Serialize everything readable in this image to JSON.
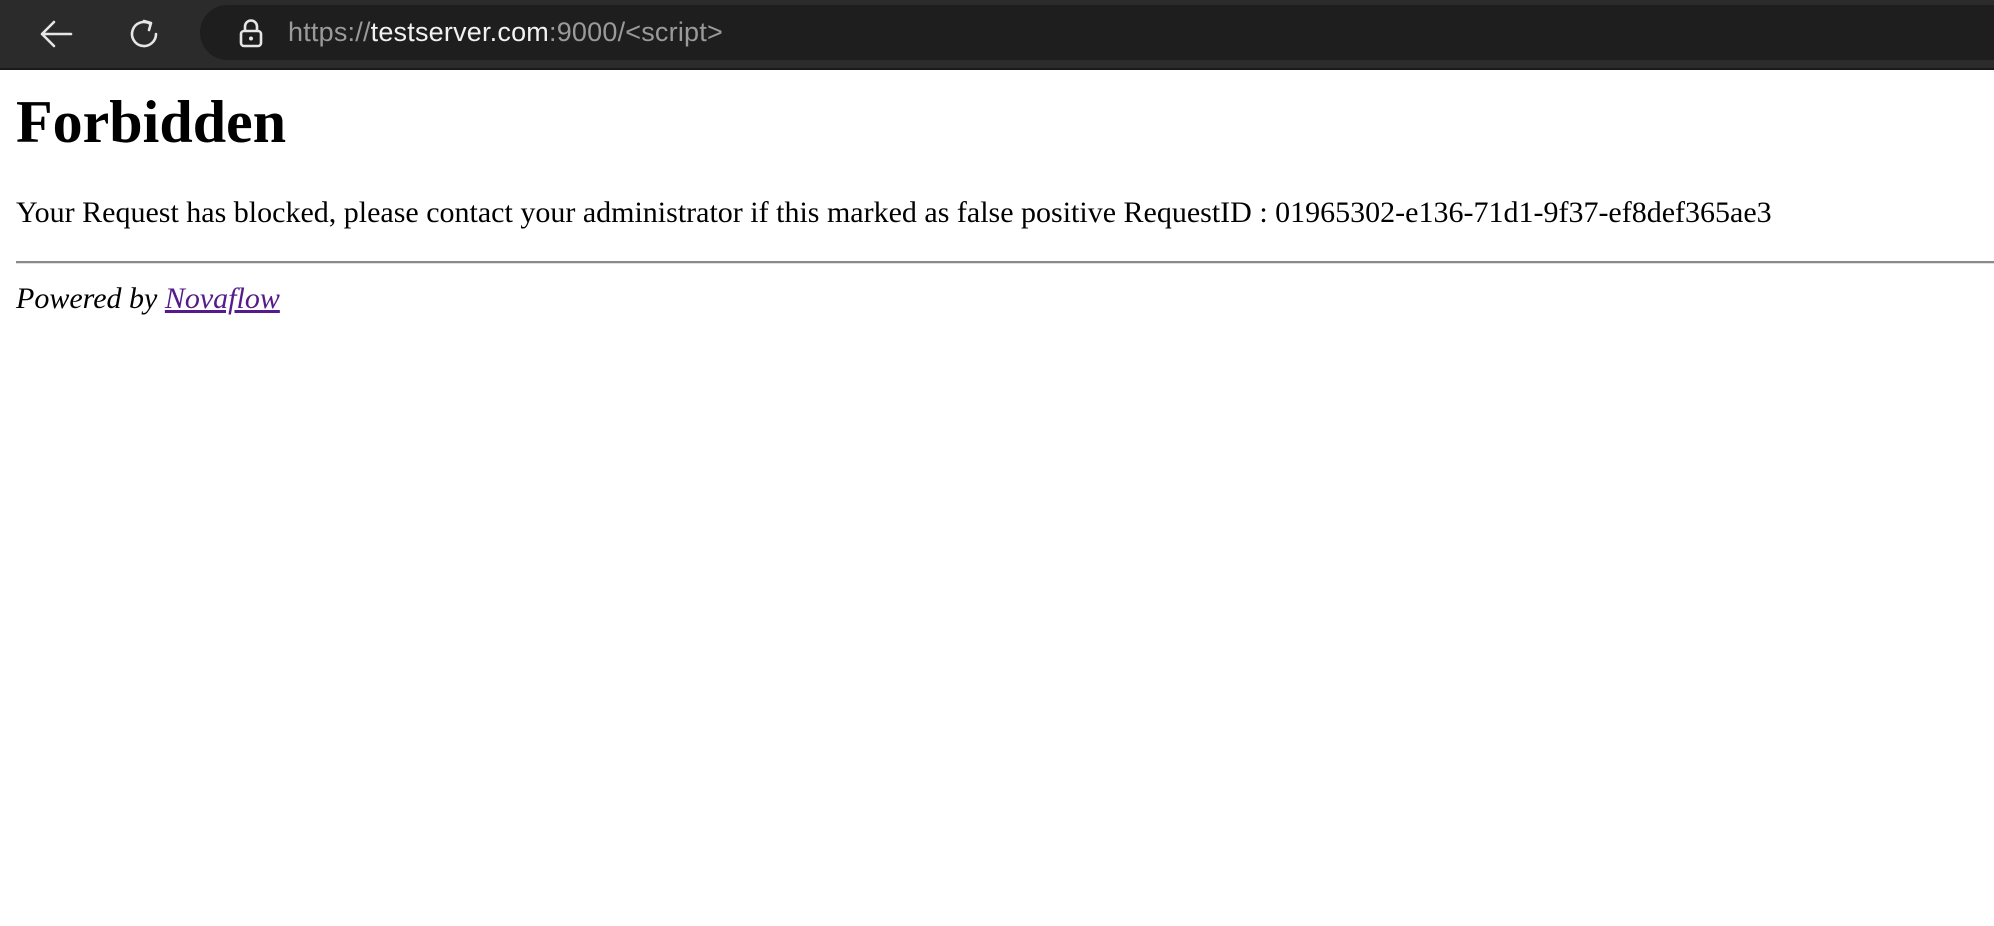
{
  "browser": {
    "url_scheme": "https://",
    "url_host": "testserver.com",
    "url_rest": ":9000/<script>"
  },
  "page": {
    "heading": "Forbidden",
    "message": "Your Request has blocked, please contact your administrator if this marked as false positive RequestID : 01965302-e136-71d1-9f37-ef8def365ae3",
    "powered_by_prefix": "Powered by ",
    "powered_by_link": "Novaflow"
  },
  "colors": {
    "toolbar_bg": "#2b2b2b",
    "urlbar_bg": "#1e1e1e",
    "visited_link": "#551a8b"
  },
  "icons": {
    "back": "arrow-left-icon",
    "reload": "reload-icon",
    "security": "lock-icon"
  }
}
